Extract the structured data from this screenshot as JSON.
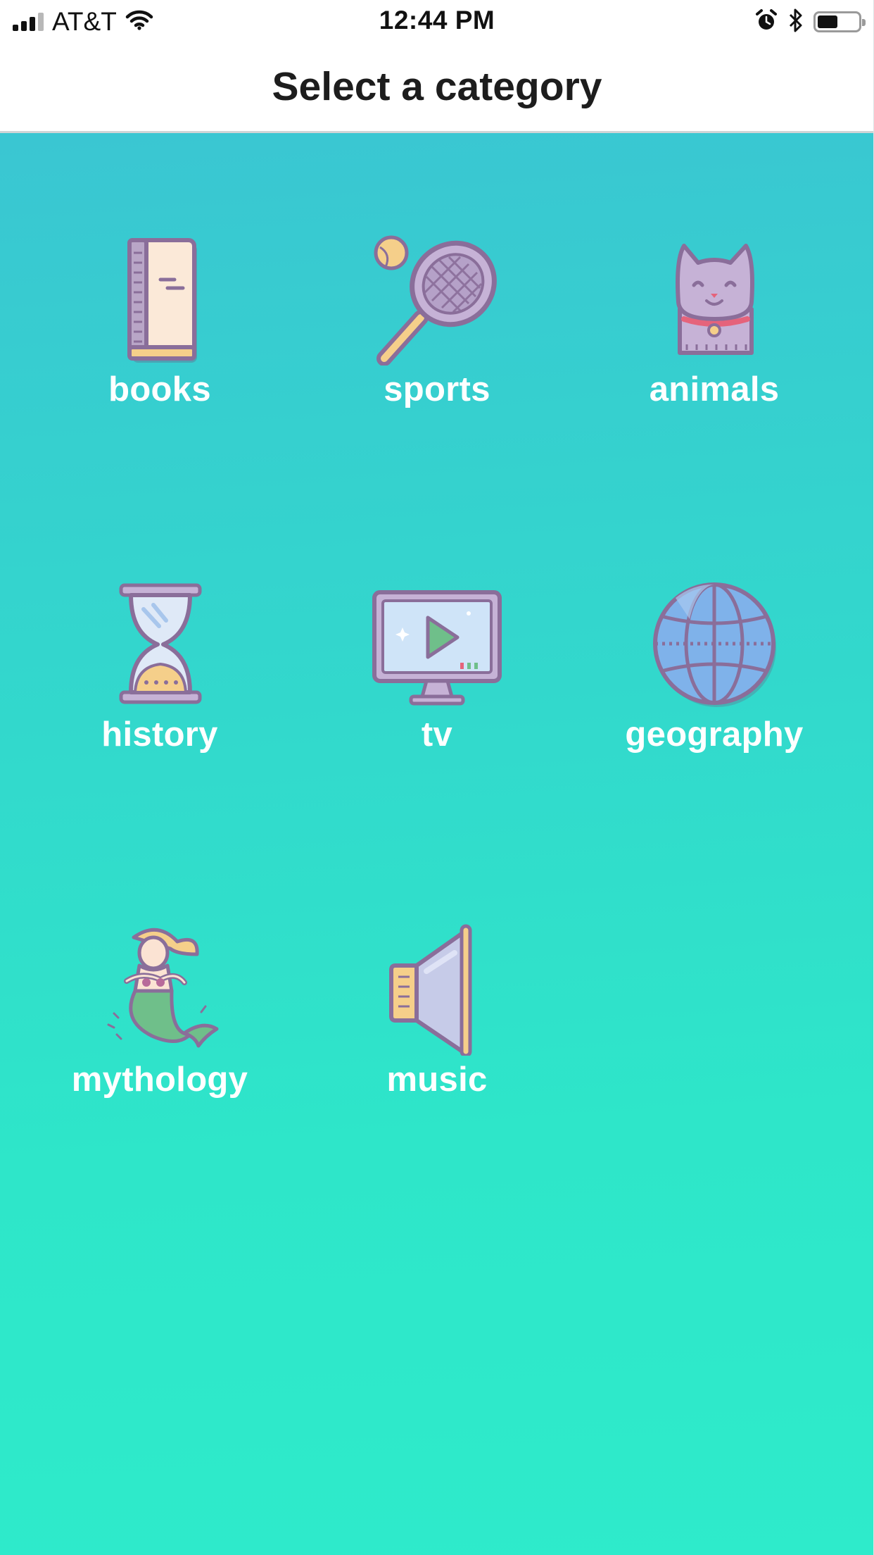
{
  "status_bar": {
    "carrier": "AT&T",
    "time": "12:44 PM",
    "icons": [
      "signal-icon",
      "wifi-icon",
      "alarm-icon",
      "bluetooth-icon",
      "battery-icon"
    ],
    "battery_level": 0.5
  },
  "nav": {
    "title": "Select a category"
  },
  "colors": {
    "gradient_top": "#3ac6d2",
    "gradient_bottom": "#2eebcb",
    "icon_outline": "#8a6e9a",
    "label": "#ffffff"
  },
  "categories": [
    {
      "label": "books",
      "icon": "book-icon"
    },
    {
      "label": "sports",
      "icon": "tennis-racket-icon"
    },
    {
      "label": "animals",
      "icon": "cat-icon"
    },
    {
      "label": "history",
      "icon": "hourglass-icon"
    },
    {
      "label": "tv",
      "icon": "tv-icon"
    },
    {
      "label": "geography",
      "icon": "globe-icon"
    },
    {
      "label": "mythology",
      "icon": "mermaid-icon"
    },
    {
      "label": "music",
      "icon": "speaker-icon"
    }
  ]
}
